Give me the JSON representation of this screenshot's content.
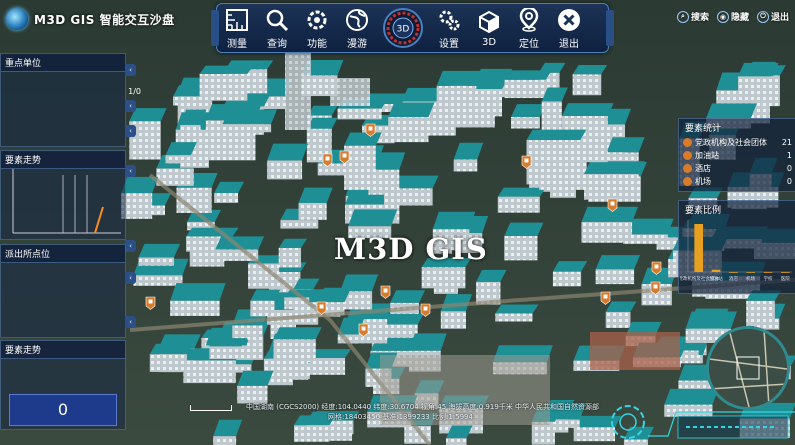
{
  "app": {
    "title": "M3D GIS 智能交互沙盘",
    "center_label": "M3D GIS"
  },
  "toolbar": {
    "buttons": [
      {
        "label": "测量",
        "icon": "ruler-icon"
      },
      {
        "label": "查询",
        "icon": "search-icon"
      },
      {
        "label": "功能",
        "icon": "gear-wrench-icon"
      },
      {
        "label": "漫游",
        "icon": "globe-icon"
      },
      {
        "label": "设置",
        "icon": "settings-icon"
      },
      {
        "label": "3D",
        "icon": "cube-icon"
      },
      {
        "label": "定位",
        "icon": "map-pin-icon"
      },
      {
        "label": "退出",
        "icon": "close-icon"
      }
    ],
    "compass_label": "3D"
  },
  "top_right": {
    "search": "搜索",
    "hide": "隐藏",
    "logout": "退出"
  },
  "left_panels": {
    "key_units": {
      "title": "重点单位",
      "page": "1/0"
    },
    "element_trend": {
      "title": "要素走势"
    },
    "police_stations": {
      "title": "派出所点位"
    },
    "element_trend_2": {
      "title": "要素走势",
      "value": "0"
    }
  },
  "element_stats": {
    "title": "要素统计",
    "rows": [
      {
        "name": "党政机构及社会团体",
        "value": "21"
      },
      {
        "name": "加油站",
        "value": "1"
      },
      {
        "name": "酒店",
        "value": "0"
      },
      {
        "name": "机场",
        "value": "0"
      }
    ]
  },
  "element_ratio": {
    "title": "要素比例",
    "categories": [
      "党政机构及社会团体",
      "加油站",
      "酒店",
      "机场",
      "学校",
      "医院"
    ],
    "values": [
      21,
      1,
      0,
      0,
      0,
      0
    ]
  },
  "status_bar": {
    "line1": "中国湖南 (CGCS2000) 经度:104.0440 纬度:30.6704 视角:45 海拔高度:0.919千米 中华人民共和国自然资源部",
    "line2": "网格:18403456 基准:1399233 比例:1:5994"
  },
  "colors": {
    "roof": "#1e8f94",
    "panel": "#16284a",
    "accent": "#4a7fc0",
    "marker": "#d87b2a"
  }
}
